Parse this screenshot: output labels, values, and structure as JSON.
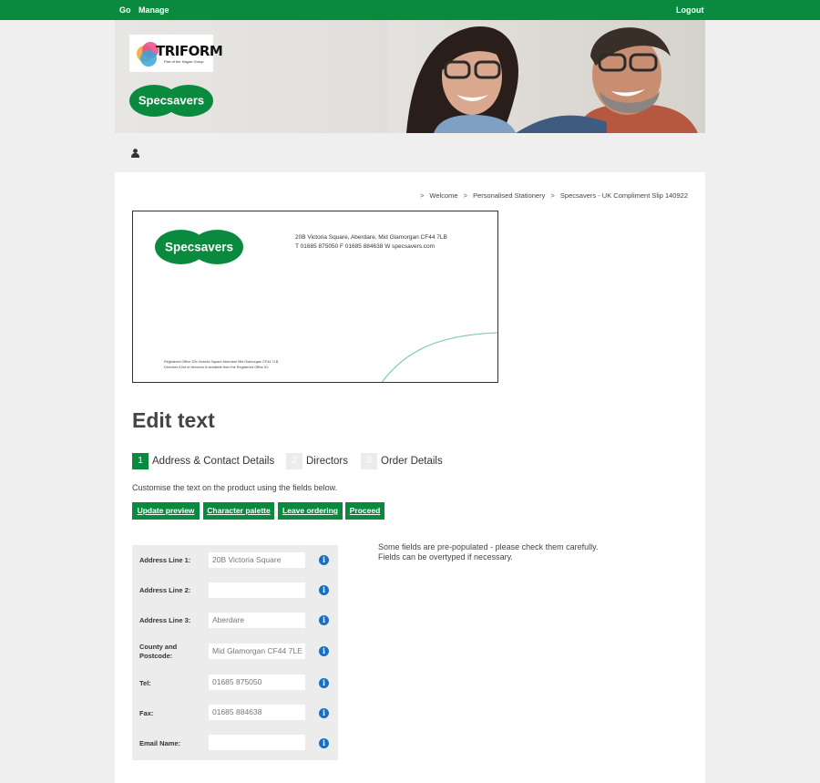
{
  "topbar": {
    "go": "Go",
    "manage": "Manage",
    "logout": "Logout"
  },
  "banner": {
    "triform_name": "TRIFORM",
    "triform_tagline": "Part of the Hague Group",
    "brand_logo_text": "Specsavers"
  },
  "breadcrumb": {
    "sep": ">",
    "items": [
      "Welcome",
      "Personalised Stationery",
      "Specsavers - UK Compliment Slip 140922"
    ]
  },
  "preview": {
    "logo_text": "Specsavers",
    "address_line": "20B Victoria Square, Aberdare, Mid Glamorgan  CF44 7LB",
    "contact_line": "T 01685 875050  F 01685 884638  W specsavers.com",
    "registered_line": "Registered Office 20b Victoria Square  Aberdare  Mid Glamorgan  CF44 7LB",
    "directors_line": "Directors A list of directors is available from the Registered Office   ID:"
  },
  "page_title": "Edit text",
  "steps": [
    {
      "num": "1",
      "label": "Address & Contact Details",
      "active": true
    },
    {
      "num": "2",
      "label": "Directors",
      "active": false
    },
    {
      "num": "3",
      "label": "Order Details",
      "active": false
    }
  ],
  "instructions": "Customise the text on the product using the fields below.",
  "buttons": {
    "update_preview": "Update preview",
    "character_palette": "Character palette",
    "leave_ordering": "Leave ordering",
    "proceed": "Proceed"
  },
  "form": {
    "fields": [
      {
        "label": "Address Line 1:",
        "value": "20B Victoria Square"
      },
      {
        "label": "Address Line 2:",
        "value": ""
      },
      {
        "label": "Address Line 3:",
        "value": "Aberdare"
      },
      {
        "label": "County and Postcode:",
        "label_line1": "County and",
        "label_line2": "Postcode:",
        "value": "Mid Glamorgan  CF44 7LE"
      },
      {
        "label": "Tel:",
        "value": "01685 875050"
      },
      {
        "label": "Fax:",
        "value": "01685 884638"
      },
      {
        "label": "Email Name:",
        "value": ""
      }
    ],
    "info_glyph": "i"
  },
  "notice": {
    "line1": "Some fields are pre-populated - please check them carefully.",
    "line2": "Fields can be overtyped if necessary."
  },
  "colors": {
    "brand_green": "#0a8a3e",
    "info_blue": "#1a6fbf",
    "panel_grey": "#ececec"
  }
}
